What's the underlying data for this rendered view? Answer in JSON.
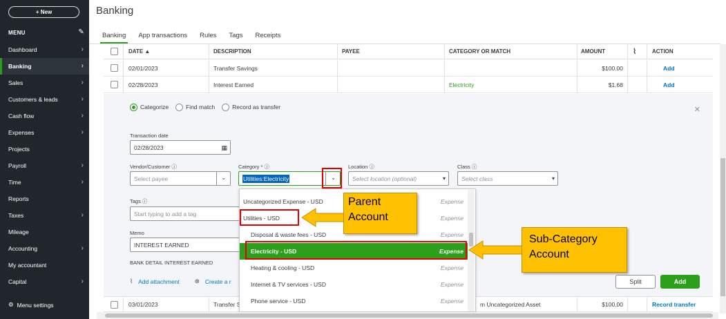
{
  "sidebar": {
    "new_label": "+ New",
    "menu_label": "MENU",
    "items": [
      {
        "label": "Dashboard",
        "chev": true
      },
      {
        "label": "Banking",
        "chev": true,
        "active": true
      },
      {
        "label": "Sales",
        "chev": true
      },
      {
        "label": "Customers & leads",
        "chev": true
      },
      {
        "label": "Cash flow",
        "chev": true
      },
      {
        "label": "Expenses",
        "chev": true
      },
      {
        "label": "Projects",
        "chev": false
      },
      {
        "label": "Payroll",
        "chev": true
      },
      {
        "label": "Time",
        "chev": true
      },
      {
        "label": "Reports",
        "chev": false
      },
      {
        "label": "Taxes",
        "chev": true
      },
      {
        "label": "Mileage",
        "chev": false
      },
      {
        "label": "Accounting",
        "chev": true
      },
      {
        "label": "My accountant",
        "chev": false
      },
      {
        "label": "Capital",
        "chev": true
      }
    ],
    "settings_label": "Menu settings"
  },
  "header": {
    "title": "Banking",
    "tabs": [
      "Banking",
      "App transactions",
      "Rules",
      "Tags",
      "Receipts"
    ]
  },
  "table": {
    "columns": {
      "date": "DATE ▲",
      "description": "DESCRIPTION",
      "payee": "PAYEE",
      "category": "CATEGORY OR MATCH",
      "amount": "AMOUNT",
      "action": "ACTION"
    },
    "rows": [
      {
        "date": "02/01/2023",
        "description": "Transfer Savings",
        "payee": "",
        "category": "",
        "amount": "$100.00",
        "action": "Add"
      },
      {
        "date": "02/28/2023",
        "description": "Interest Earned",
        "payee": "",
        "category": "Electricity",
        "amount": "$1.68",
        "action": "Add"
      },
      {
        "date": "03/01/2023",
        "description": "Transfer S",
        "payee": "",
        "category": "m Uncategorized Asset",
        "amount": "$100.00",
        "action": "Record transfer"
      }
    ]
  },
  "panel": {
    "radio_categorize": "Categorize",
    "radio_find_match": "Find match",
    "radio_record_transfer": "Record as transfer",
    "transaction_date_label": "Transaction date",
    "transaction_date_value": "02/28/2023",
    "vendor_label": "Vendor/Customer",
    "vendor_placeholder": "Select payee",
    "category_label": "Category *",
    "category_value": "Utilities:Electricity",
    "location_label": "Location",
    "location_placeholder": "Select location (optional)",
    "class_label": "Class",
    "class_placeholder": "Select class",
    "tags_label": "Tags",
    "tags_placeholder": "Start typing to add a tag",
    "memo_label": "Memo",
    "memo_value": "INTEREST EARNED",
    "bank_detail": "BANK DETAIL INTEREST EARNED",
    "add_attachment": "Add attachment",
    "create_rule": "Create a r",
    "split_label": "Split",
    "add_label": "Add"
  },
  "dropdown": {
    "items": [
      {
        "name": "Uncategorized Expense - USD",
        "type": "Expense"
      },
      {
        "name": "Utilities - USD",
        "type": "Expense"
      },
      {
        "name": "Disposal & waste fees - USD",
        "type": "Expense"
      },
      {
        "name": "Electricity - USD",
        "type": "Expense"
      },
      {
        "name": "Heating & cooling - USD",
        "type": "Expense"
      },
      {
        "name": "Internet & TV services - USD",
        "type": "Expense"
      },
      {
        "name": "Phone service - USD",
        "type": "Expense"
      }
    ]
  },
  "annotations": {
    "parent_l1": "Parent",
    "parent_l2": "Account",
    "sub_l1": "Sub-Category",
    "sub_l2": "Account"
  },
  "colors": {
    "accent": "#2ca01c",
    "link": "#0077c5",
    "sidebar": "#21262c",
    "callout": "#ffc000",
    "annotation": "#e00000"
  }
}
